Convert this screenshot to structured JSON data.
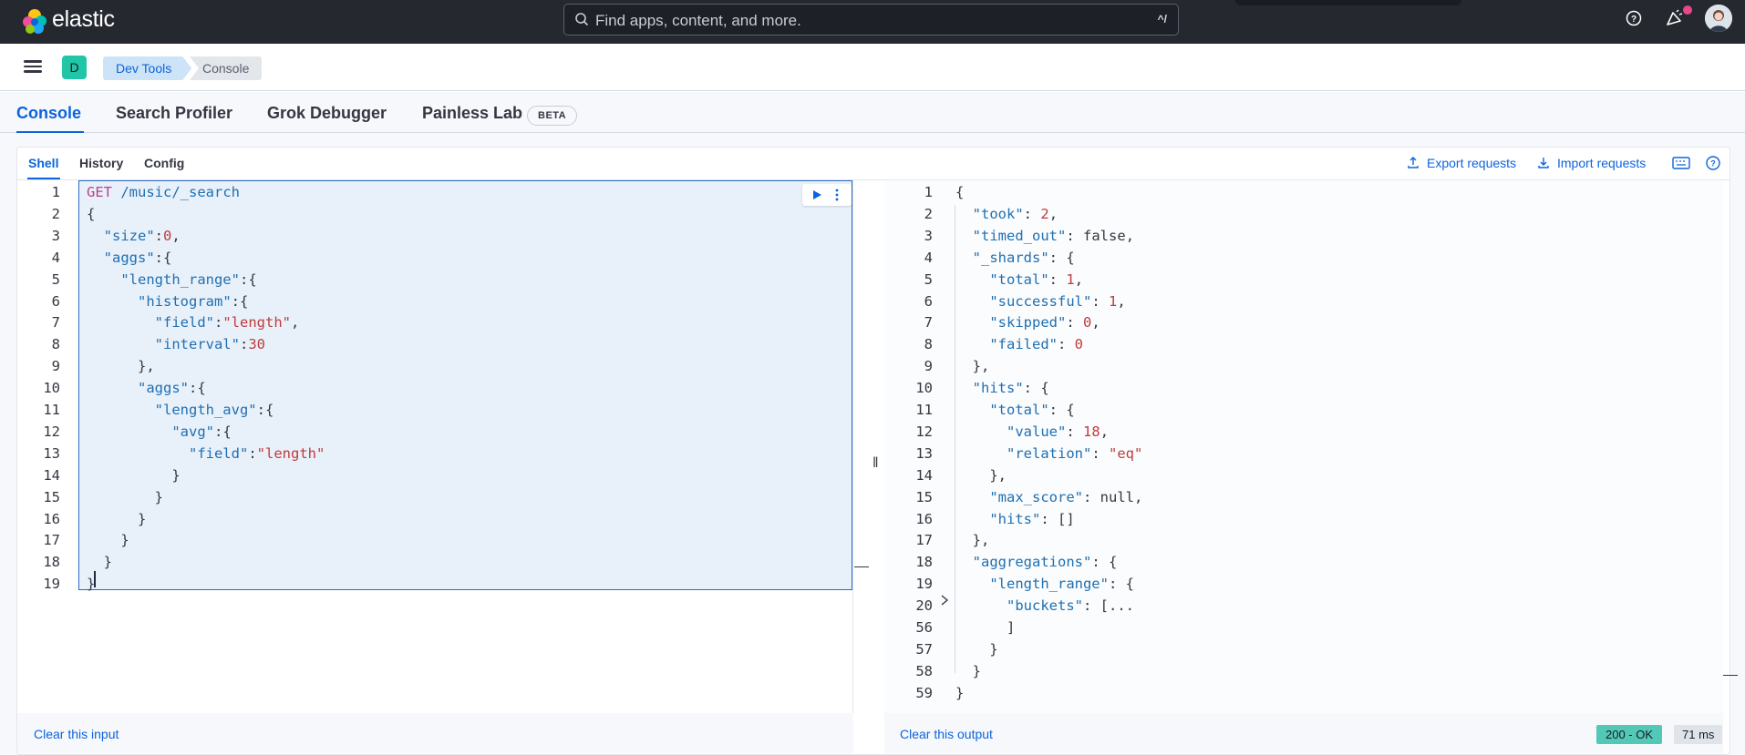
{
  "header": {
    "brand": "elastic",
    "search_placeholder": "Find apps, content, and more.",
    "search_shortcut": "^/"
  },
  "breadcrumb": {
    "space_initial": "D",
    "items": [
      "Dev Tools",
      "Console"
    ]
  },
  "app_tabs": [
    {
      "label": "Console",
      "active": true
    },
    {
      "label": "Search Profiler",
      "active": false
    },
    {
      "label": "Grok Debugger",
      "active": false
    },
    {
      "label": "Painless Lab",
      "active": false
    }
  ],
  "beta_badge": "BETA",
  "console": {
    "subtabs": [
      {
        "label": "Shell",
        "active": true
      },
      {
        "label": "History",
        "active": false
      },
      {
        "label": "Config",
        "active": false
      }
    ],
    "export_label": "Export requests",
    "import_label": "Import requests",
    "request": {
      "line_numbers": [
        "1",
        "2",
        "3",
        "4",
        "5",
        "6",
        "7",
        "8",
        "9",
        "10",
        "11",
        "12",
        "13",
        "14",
        "15",
        "16",
        "17",
        "18",
        "19"
      ],
      "lines": [
        "GET /music/_search",
        "{",
        "  \"size\":0,",
        "  \"aggs\":{",
        "    \"length_range\":{",
        "      \"histogram\":{",
        "        \"field\":\"length\",",
        "        \"interval\":30",
        "      },",
        "      \"aggs\":{",
        "        \"length_avg\":{",
        "          \"avg\":{",
        "            \"field\":\"length\"",
        "          }",
        "        }",
        "      }",
        "    }",
        "  }",
        "}"
      ]
    },
    "response": {
      "line_numbers": [
        "1",
        "2",
        "3",
        "4",
        "5",
        "6",
        "7",
        "8",
        "9",
        "10",
        "11",
        "12",
        "13",
        "14",
        "15",
        "16",
        "17",
        "18",
        "19",
        "20",
        "56",
        "57",
        "58",
        "59"
      ],
      "lines": [
        "{",
        "  \"took\": 2,",
        "  \"timed_out\": false,",
        "  \"_shards\": {",
        "    \"total\": 1,",
        "    \"successful\": 1,",
        "    \"skipped\": 0,",
        "    \"failed\": 0",
        "  },",
        "  \"hits\": {",
        "    \"total\": {",
        "      \"value\": 18,",
        "      \"relation\": \"eq\"",
        "    },",
        "    \"max_score\": null,",
        "    \"hits\": []",
        "  },",
        "  \"aggregations\": {",
        "    \"length_range\": {",
        "      \"buckets\": [...",
        "      ]",
        "    }",
        "  }",
        "}"
      ]
    },
    "clear_input_label": "Clear this input",
    "clear_output_label": "Clear this output",
    "status": "200 - OK",
    "duration": "71 ms"
  }
}
